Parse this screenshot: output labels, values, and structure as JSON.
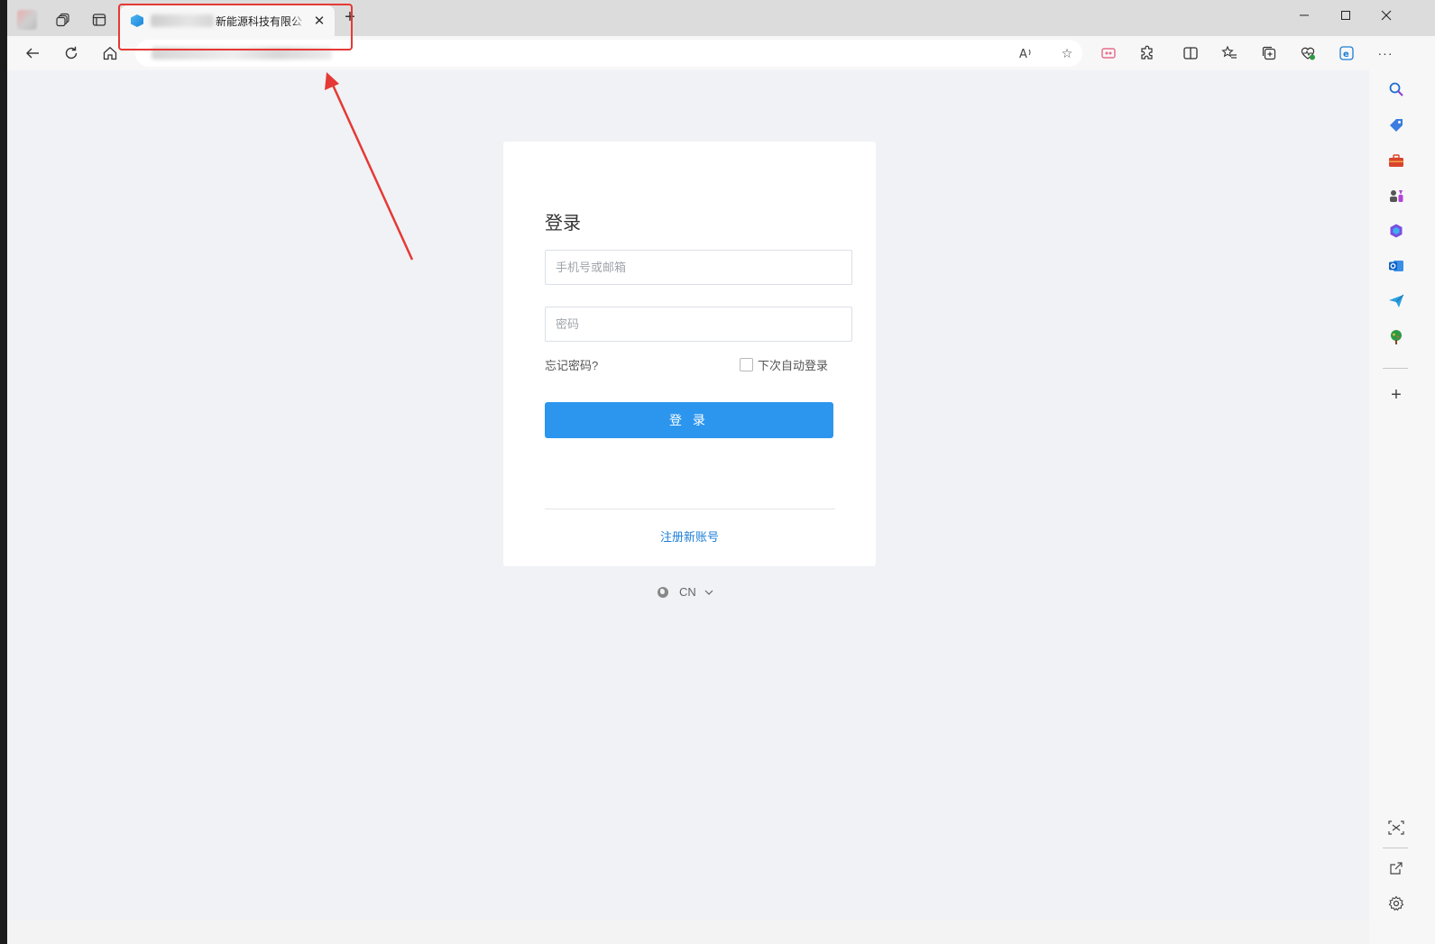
{
  "browser": {
    "tab": {
      "title": "新能源科技有限公",
      "close_glyph": "✕"
    },
    "new_tab_glyph": "+",
    "window_controls": {
      "minimize": "—",
      "maximize": "☐",
      "close": "✕"
    },
    "toolbar": {
      "back": "←",
      "refresh": "↻",
      "home": "⌂",
      "read_aloud": "A′",
      "favorite": "☆",
      "more": "···"
    },
    "colors": {
      "accent_red": "#e53935",
      "button_blue": "#2c96ee",
      "link_blue": "#1e7fd8"
    }
  },
  "sidebar": {
    "items": [
      "search-icon",
      "tag-icon",
      "toolbox-icon",
      "games-icon",
      "office-icon",
      "outlook-icon",
      "send-icon",
      "tree-icon"
    ],
    "add": "+"
  },
  "login": {
    "title": "登录",
    "phone_placeholder": "手机号或邮箱",
    "password_placeholder": "密码",
    "forgot": "忘记密码?",
    "remember": "下次自动登录",
    "submit": "登 录",
    "register": "注册新账号",
    "lang": "CN"
  }
}
